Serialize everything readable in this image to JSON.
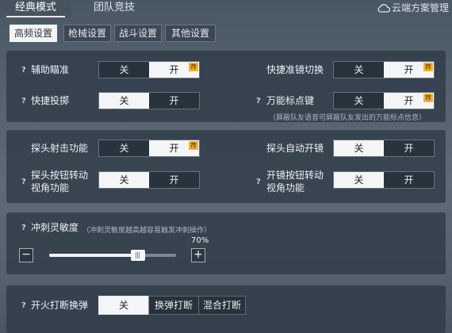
{
  "top_tabs": [
    {
      "label": "经典模式",
      "active": true
    },
    {
      "label": "团队竞技",
      "active": false
    }
  ],
  "cloud": {
    "label": "云端方案管理",
    "icon": "cloud-icon"
  },
  "sub_tabs": [
    {
      "label": "高频设置",
      "active": true
    },
    {
      "label": "枪械设置",
      "active": false
    },
    {
      "label": "战斗设置",
      "active": false
    },
    {
      "label": "其他设置",
      "active": false
    }
  ],
  "toggle_options": {
    "off": "关",
    "on": "开"
  },
  "badge_text": "荐",
  "settings": {
    "aim_assist": {
      "label": "辅助瞄准",
      "value": "开",
      "recommended": true
    },
    "scope_switch": {
      "label": "快捷准镜切换",
      "value": "开",
      "recommended": true
    },
    "quick_throw": {
      "label": "快捷投掷",
      "value": "关"
    },
    "marker_key": {
      "label": "万能标点键",
      "value": "开",
      "recommended": true,
      "hint": "（屏蔽队友语音可屏蔽队友发出的万能标点信息）"
    },
    "peek_fire": {
      "label": "探头射击功能",
      "value": "开",
      "recommended": true
    },
    "peek_auto_scope": {
      "label": "探头自动开镜",
      "value": "关"
    },
    "peek_button_view_line1": "探头按钮转动",
    "peek_button_view_line2": "视角功能",
    "peek_button_view": {
      "value": "关"
    },
    "scope_button_view_line1": "开镜按钮转动",
    "scope_button_view_line2": "视角功能",
    "scope_button_view": {
      "value": "关"
    }
  },
  "sprint_sensitivity": {
    "label": "冲刺灵敏度",
    "hint": "（冲刺灵敏度越高越容易触发冲刺操作）",
    "value_text": "70%",
    "value": 0.7,
    "minus": "−",
    "plus": "+"
  },
  "fire_interrupt": {
    "label": "开火打断换弹",
    "options": [
      "关",
      "换弹打断",
      "混合打断"
    ],
    "selected": "关"
  },
  "colors": {
    "accent": "#f0b43a",
    "selected": "#f4f5f7",
    "panel": "#2e3a46"
  }
}
